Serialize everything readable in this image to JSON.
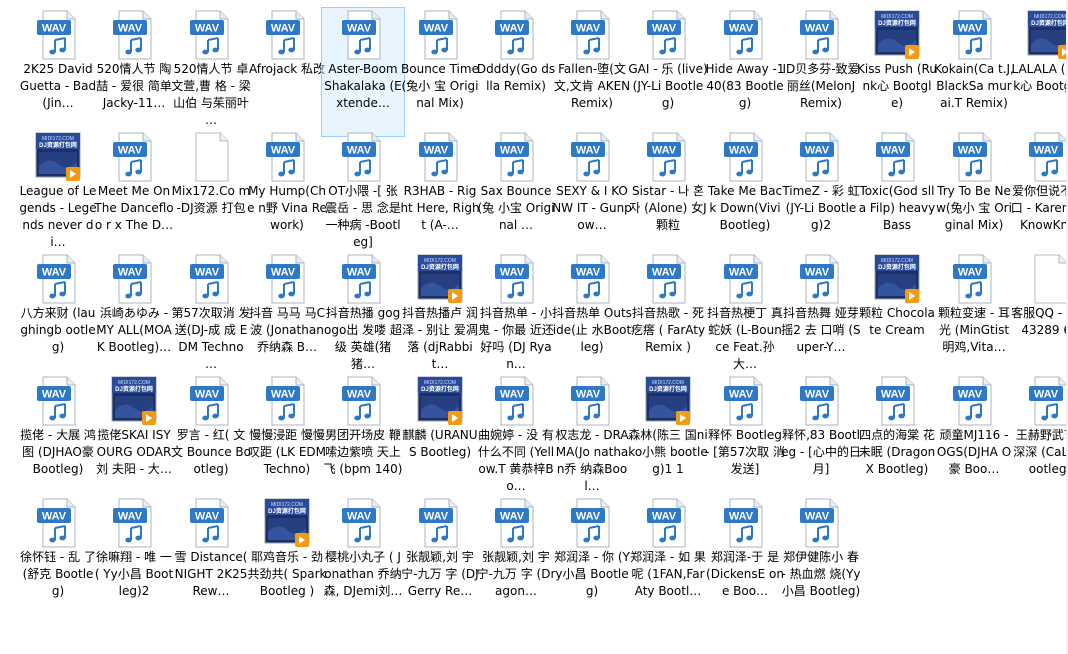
{
  "window": {
    "accent": "#1e73be"
  },
  "files": [
    {
      "label": "2K25 David Guetta - Bad (Jin…",
      "icon": "wav-icon"
    },
    {
      "label": "520情人节 陶喆 - 爱很 简单 Jacky-11…",
      "icon": "wav-icon"
    },
    {
      "label": "520情人节 卓文萱,曹 格 - 梁山伯 与茱丽叶 …",
      "icon": "wav-icon"
    },
    {
      "label": "Afrojack 私改",
      "icon": "wav-icon"
    },
    {
      "label": "Aster-Boom Shakalaka (Extende…",
      "icon": "wav-icon",
      "selected": true
    },
    {
      "label": "Bounce Time(兔小 宝 Original Mix)",
      "icon": "wav-icon"
    },
    {
      "label": "Ddddy(Go dslla Remix)",
      "icon": "wav-icon"
    },
    {
      "label": "Fallen-堕(文文,文肯 AKEN Remix)",
      "icon": "wav-icon"
    },
    {
      "label": "GAI - 乐 (live)(JY-Li Bootleg)",
      "icon": "wav-icon"
    },
    {
      "label": "Hide Away -140(83 Bootleg)",
      "icon": "wav-icon"
    },
    {
      "label": "ID贝多芬-致爱丽丝(MelonJ Remix)",
      "icon": "wav-icon"
    },
    {
      "label": "Kiss Push (Runk心 Bootgle)",
      "icon": "dj-icon",
      "thumb": "MIDI172.COM DJ资源打包网"
    },
    {
      "label": "Kokain(Ca t.J,BlackSa murai.T Remix)",
      "icon": "wav-icon"
    },
    {
      "label": "LALALA (Runk心 Bootgle)",
      "icon": "dj-icon",
      "thumb": "MIDI172.COM DJ资源打包网"
    },
    {
      "label": "League of Legends - Legends never di…",
      "icon": "dj-icon",
      "thumb": "MIDI172.COM DJ资源打包网"
    },
    {
      "label": "Meet Me On The Dancefloo r x The D…",
      "icon": "wav-icon"
    },
    {
      "label": "Mix172.Co m-DJ资源 打包",
      "icon": "doc-icon"
    },
    {
      "label": "My Hump(Che n野 Vina Rework)",
      "icon": "wav-icon"
    },
    {
      "label": "OT小隈 -[ 张震岳 - 思 念是一种病 -Bootleg]",
      "icon": "wav-icon"
    },
    {
      "label": "R3HAB - Right Here, Right (A-…",
      "icon": "wav-icon"
    },
    {
      "label": "Sax Bounce(兔 小宝 Original …",
      "icon": "wav-icon"
    },
    {
      "label": "SEXY & I KONW IT - Gunpow…",
      "icon": "wav-icon"
    },
    {
      "label": "Sistar - 나 혼자 (Alone) 女J 颗粒",
      "icon": "wav-icon"
    },
    {
      "label": "Take Me Back Down(Vivi Bootleg)",
      "icon": "wav-icon"
    },
    {
      "label": "TimeZ - 彩 虹(JY-Li Bootleg)2",
      "icon": "wav-icon"
    },
    {
      "label": "Toxic(God slla Filp) heavy Bass",
      "icon": "wav-icon"
    },
    {
      "label": "Try To Be New(兔小 宝 Original Mix)",
      "icon": "wav-icon"
    },
    {
      "label": "爱你但说不 出口 - Karencici KnowKn…",
      "icon": "wav-icon"
    },
    {
      "label": "八方来财 (laughingb ootleg)",
      "icon": "wav-icon"
    },
    {
      "label": "浜崎あゆみ - MY ALL(MOAK Bootleg)…",
      "icon": "wav-icon"
    },
    {
      "label": "第57次取消 发送(DJ-成 成 EDM Techno …",
      "icon": "wav-icon"
    },
    {
      "label": "抖音 马马 马C波 (Jonathan 乔纳森 B…",
      "icon": "wav-icon"
    },
    {
      "label": "抖音热播 gogogo出 发喽 超级 英雄(猪猪…",
      "icon": "wav-icon"
    },
    {
      "label": "抖音热播卢 润泽 - 别让 爱凋落 (djRabbit…",
      "icon": "dj-icon",
      "thumb": "MIDI172.COM DJ资源打包网"
    },
    {
      "label": "抖音热单 - 小鬼 - 你最 近还好吗 (DJ Ryan…",
      "icon": "wav-icon"
    },
    {
      "label": "抖音热单 Outside(止 水Bootleg)",
      "icon": "wav-icon"
    },
    {
      "label": "抖音热歌 - 死疙瘩 ( FarAty Remix )",
      "icon": "wav-icon"
    },
    {
      "label": "抖音热梗丁 真蛇妖 (L-Bounce Feat.孙大…",
      "icon": "wav-icon"
    },
    {
      "label": "抖音热舞 娅芽摇2 去 口哨 (Super-Y…",
      "icon": "wav-icon"
    },
    {
      "label": "颗粒 Chocolate Cream",
      "icon": "dj-icon",
      "thumb": "MIDI172.COM DJ资源打包网"
    },
    {
      "label": "颗粒变速 - 耳光 (MinGtist 明鸡,Vita…",
      "icon": "wav-icon"
    },
    {
      "label": "客服QQ - 10443289 64",
      "icon": "doc-icon"
    },
    {
      "label": "揽佬 - 大展 鸿图 (DJHAO豪 Bootleg)",
      "icon": "wav-icon"
    },
    {
      "label": "揽佬SKAI ISYOURG ODAR 刘 夫阳 - 大…",
      "icon": "dj-icon",
      "thumb": "MIDI172.COM DJ资源打包网"
    },
    {
      "label": "罗言 - 红( 文文 Bounce Bootleg)",
      "icon": "wav-icon"
    },
    {
      "label": "慢慢浸距 慢慢叹距 (LK EDM Techno)",
      "icon": "wav-icon"
    },
    {
      "label": "男团开场皮 鞭嗦边紫喷 天上飞 (bpm 140)",
      "icon": "wav-icon"
    },
    {
      "label": "麒麟 (URANUS Bootleg)",
      "icon": "dj-icon",
      "thumb": "MIDI172.COM DJ资源打包网"
    },
    {
      "label": "曲婉婷 - 没 有什么不同 (Yellow.T 黄恭梓Bo…",
      "icon": "wav-icon"
    },
    {
      "label": "权志龙 - DRAMA(Jo nathan乔 纳森Bool…",
      "icon": "wav-icon"
    },
    {
      "label": "森林(陈三 国niko小熊 bootleg)1 1",
      "icon": "dj-icon",
      "thumb": "MIDI172.COM DJ资源打包网"
    },
    {
      "label": "释怀 Bootleg - [第57次取 消发送]",
      "icon": "wav-icon"
    },
    {
      "label": "释怀,83 Bootleg - [心中的日 月]",
      "icon": "wav-icon"
    },
    {
      "label": "四点的海棠 花未眠 (DragonX Bootleg)",
      "icon": "wav-icon"
    },
    {
      "label": "顽童MJ116 - OGS(DJHA O豪 Boo…",
      "icon": "wav-icon"
    },
    {
      "label": "王赫野武艺 - 深深 (CaLo bootleg)",
      "icon": "wav-icon"
    },
    {
      "label": "徐怀钰 - 乱 了(舒克 Bootleg)",
      "icon": "wav-icon"
    },
    {
      "label": "徐嘛翔 - 唯 一 ( Yy小昌 Bootleg)2",
      "icon": "wav-icon"
    },
    {
      "label": "雪 Distance( NIGHT 2K25Rew…",
      "icon": "wav-icon"
    },
    {
      "label": "耶鸡音乐 - 劲共劲共( Spark Bootleg )",
      "icon": "dj-icon",
      "thumb": "MIDI172.COM DJ资源打包网"
    },
    {
      "label": "樱桃小丸子 ( Jonathan 乔纳森, DJemi刘…",
      "icon": "wav-icon"
    },
    {
      "label": "张靓颖,刘 宇宁-九万 字 (DJ Gerry Re…",
      "icon": "wav-icon"
    },
    {
      "label": "张靓颖,刘 宇宁-九万 字 (Dragon…",
      "icon": "wav-icon"
    },
    {
      "label": "郑润泽 - 你 (Yy小昌 Bootleg)",
      "icon": "wav-icon"
    },
    {
      "label": "郑润泽 - 如 果呢 (1FAN,Far Aty Bootl…",
      "icon": "wav-icon"
    },
    {
      "label": "郑润泽-于 是 (DickensE one Boo…",
      "icon": "wav-icon"
    },
    {
      "label": "郑伊健陈小 春 - 热血燃 烧(Yy小昌 Bootleg)",
      "icon": "wav-icon"
    }
  ],
  "icon_text": {
    "wav": "WAV"
  }
}
